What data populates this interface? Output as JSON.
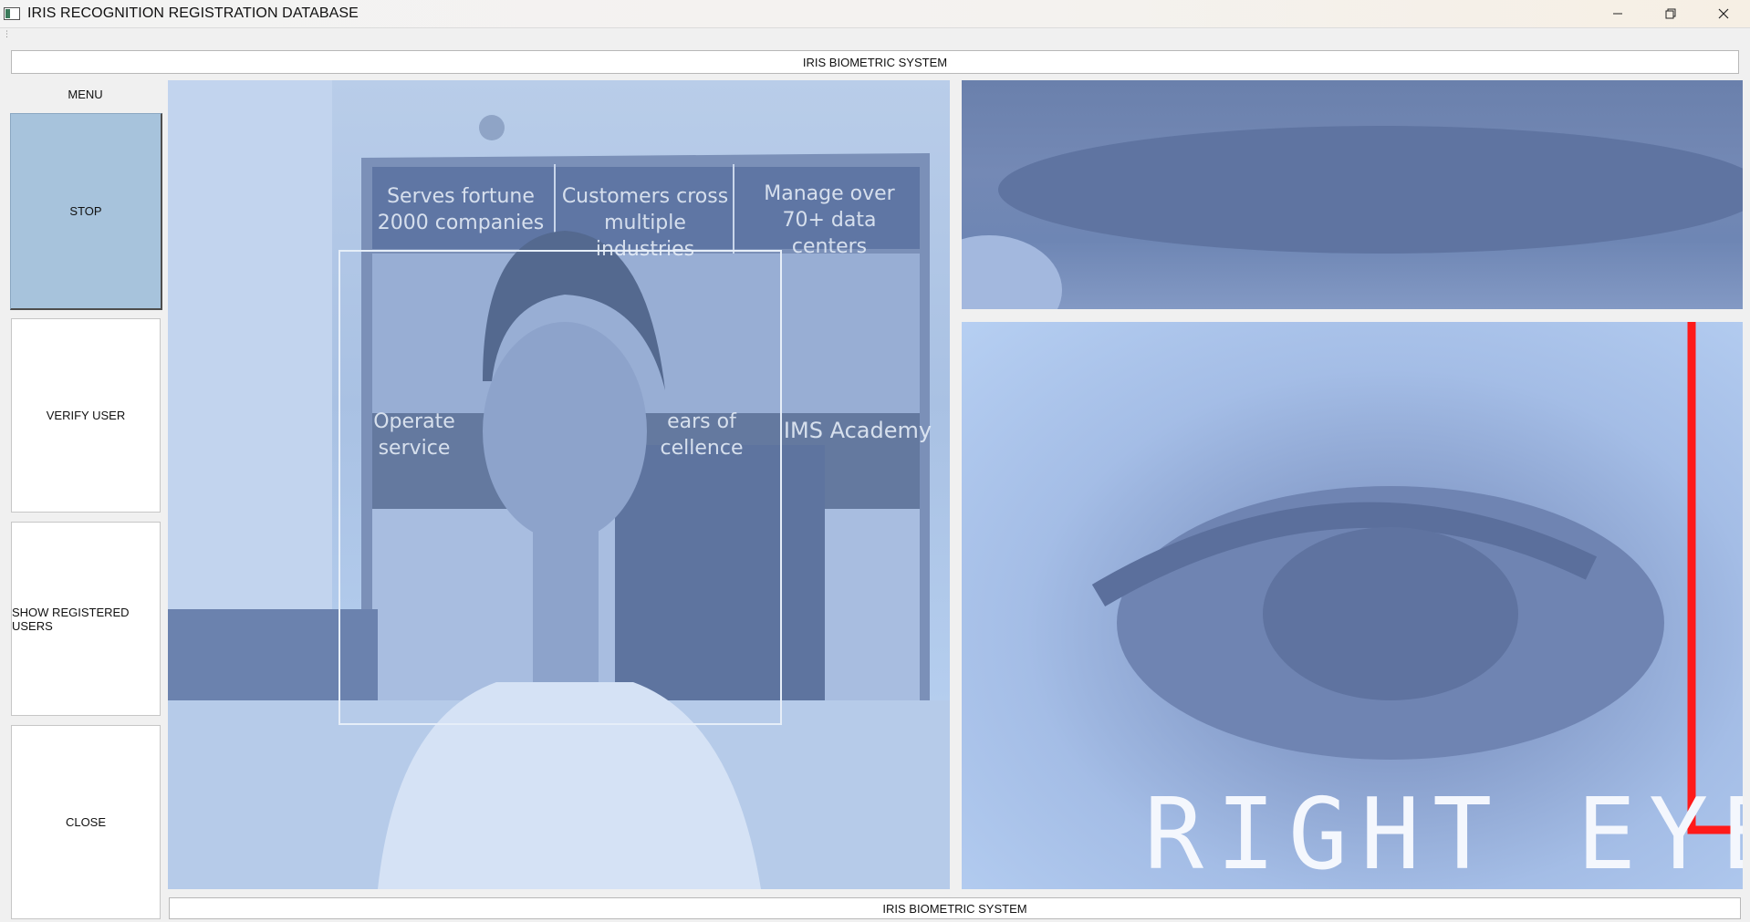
{
  "window": {
    "title": "IRIS RECOGNITION REGISTRATION DATABASE",
    "icon": "app-window-icon",
    "controls": [
      "minimize-icon",
      "restore-icon",
      "close-icon"
    ]
  },
  "header": {
    "label": "IRIS BIOMETRIC SYSTEM"
  },
  "sidebar": {
    "title": "MENU",
    "buttons": [
      {
        "label": "STOP",
        "active": true
      },
      {
        "label": "VERIFY USER",
        "active": false
      },
      {
        "label": "SHOW REGISTERED USERS",
        "active": false
      },
      {
        "label": "CLOSE",
        "active": false
      }
    ]
  },
  "camera": {
    "poster_texts": [
      "Serves fortune 2000 companies",
      "Customers cross multiple industries",
      "Manage over 70+ data centers",
      "Operate service",
      "ears of cellence",
      "IMS Academy"
    ],
    "eye_label": "RIGHT EYE",
    "face_box_color": "#e6eef8",
    "eye_marker_color": "#ff1a1a"
  },
  "footer": {
    "label": "IRIS BIOMETRIC SYSTEM"
  }
}
